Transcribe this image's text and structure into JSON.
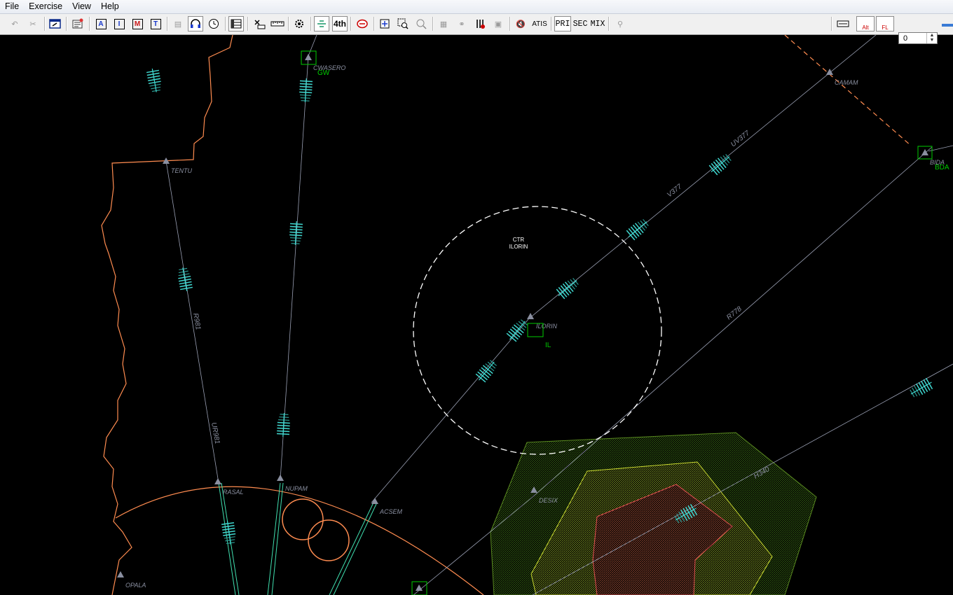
{
  "menu": [
    "File",
    "Exercise",
    "View",
    "Help"
  ],
  "toolbar": {
    "atis_label": "ATIS",
    "pri_label": "PRI",
    "sec_label": "SEC",
    "mix_label": "MIX",
    "fourth_label": "4th",
    "a_label": "A",
    "i_label": "I",
    "m_label": "M",
    "t_label": "T",
    "alt_label": "Alt",
    "fl_label": "FL",
    "fl_value": "0"
  },
  "colors": {
    "background": "#000000",
    "route": "#9aa0b4",
    "highlight_route": "#40e0b0",
    "boundary": "#ff8c50",
    "aircraft_track": "#40d8d0",
    "airport": "#00cc00",
    "zone_outer": "#5a8a20",
    "zone_mid": "#c8d830",
    "zone_inner": "#e05050"
  },
  "waypoints": [
    "TENTU",
    "CWASERO",
    "CAMAM",
    "BIDA",
    "ILORIN",
    "RASAL",
    "NUPAM",
    "ACSEM",
    "DESIX",
    "OPALA"
  ],
  "airports": [
    {
      "code": "GW"
    },
    {
      "code": "BDA"
    },
    {
      "code": "IL"
    }
  ],
  "routes": [
    "R981",
    "UR981",
    "V377",
    "UV377",
    "R778",
    "H340"
  ],
  "ctr": {
    "line1": "CTR",
    "line2": "ILORIN"
  }
}
